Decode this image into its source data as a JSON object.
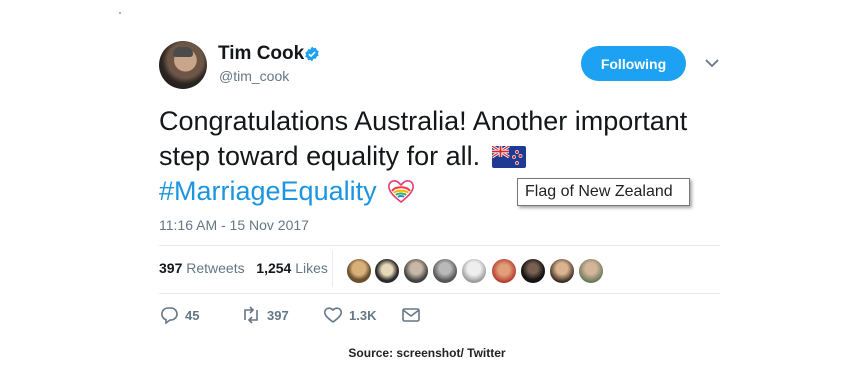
{
  "tweet": {
    "author_name": "Tim Cook",
    "handle": "@tim_cook",
    "follow_label": "Following",
    "text_line1": "Congratulations Australia! Another important",
    "text_line2": "step toward equality for all.",
    "hashtag": "#MarriageEquality",
    "timestamp": "11:16 AM - 15 Nov 2017",
    "tooltip": "Flag of New Zealand"
  },
  "stats": {
    "retweets_count": "397",
    "retweets_label": "Retweets",
    "likes_count": "1,254",
    "likes_label": "Likes"
  },
  "actions": {
    "replies": "45",
    "retweets": "397",
    "likes": "1.3K"
  },
  "caption": "Source: screenshot/ Twitter",
  "colors": {
    "accent": "#1da1f2",
    "hashtag": "#1b95e0",
    "muted": "#657786",
    "text": "#14171a"
  },
  "icons": [
    "verified-badge-icon",
    "chevron-down-icon",
    "new-zealand-flag-emoji",
    "rainbow-heart-emoji",
    "reply-icon",
    "retweet-icon",
    "like-icon",
    "direct-message-icon"
  ]
}
